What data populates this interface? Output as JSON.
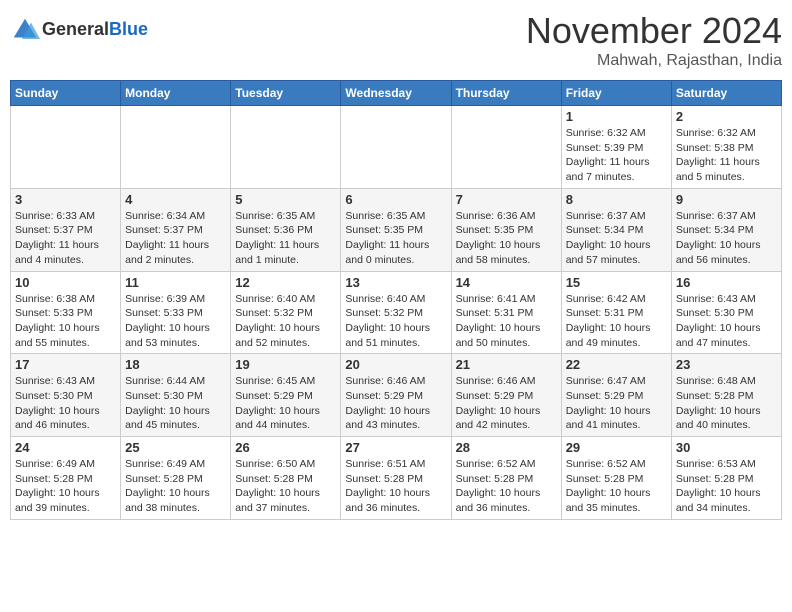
{
  "header": {
    "logo_line1": "General",
    "logo_line2": "Blue",
    "month": "November 2024",
    "location": "Mahwah, Rajasthan, India"
  },
  "weekdays": [
    "Sunday",
    "Monday",
    "Tuesday",
    "Wednesday",
    "Thursday",
    "Friday",
    "Saturday"
  ],
  "weeks": [
    [
      {
        "day": "",
        "info": ""
      },
      {
        "day": "",
        "info": ""
      },
      {
        "day": "",
        "info": ""
      },
      {
        "day": "",
        "info": ""
      },
      {
        "day": "",
        "info": ""
      },
      {
        "day": "1",
        "info": "Sunrise: 6:32 AM\nSunset: 5:39 PM\nDaylight: 11 hours and 7 minutes."
      },
      {
        "day": "2",
        "info": "Sunrise: 6:32 AM\nSunset: 5:38 PM\nDaylight: 11 hours and 5 minutes."
      }
    ],
    [
      {
        "day": "3",
        "info": "Sunrise: 6:33 AM\nSunset: 5:37 PM\nDaylight: 11 hours and 4 minutes."
      },
      {
        "day": "4",
        "info": "Sunrise: 6:34 AM\nSunset: 5:37 PM\nDaylight: 11 hours and 2 minutes."
      },
      {
        "day": "5",
        "info": "Sunrise: 6:35 AM\nSunset: 5:36 PM\nDaylight: 11 hours and 1 minute."
      },
      {
        "day": "6",
        "info": "Sunrise: 6:35 AM\nSunset: 5:35 PM\nDaylight: 11 hours and 0 minutes."
      },
      {
        "day": "7",
        "info": "Sunrise: 6:36 AM\nSunset: 5:35 PM\nDaylight: 10 hours and 58 minutes."
      },
      {
        "day": "8",
        "info": "Sunrise: 6:37 AM\nSunset: 5:34 PM\nDaylight: 10 hours and 57 minutes."
      },
      {
        "day": "9",
        "info": "Sunrise: 6:37 AM\nSunset: 5:34 PM\nDaylight: 10 hours and 56 minutes."
      }
    ],
    [
      {
        "day": "10",
        "info": "Sunrise: 6:38 AM\nSunset: 5:33 PM\nDaylight: 10 hours and 55 minutes."
      },
      {
        "day": "11",
        "info": "Sunrise: 6:39 AM\nSunset: 5:33 PM\nDaylight: 10 hours and 53 minutes."
      },
      {
        "day": "12",
        "info": "Sunrise: 6:40 AM\nSunset: 5:32 PM\nDaylight: 10 hours and 52 minutes."
      },
      {
        "day": "13",
        "info": "Sunrise: 6:40 AM\nSunset: 5:32 PM\nDaylight: 10 hours and 51 minutes."
      },
      {
        "day": "14",
        "info": "Sunrise: 6:41 AM\nSunset: 5:31 PM\nDaylight: 10 hours and 50 minutes."
      },
      {
        "day": "15",
        "info": "Sunrise: 6:42 AM\nSunset: 5:31 PM\nDaylight: 10 hours and 49 minutes."
      },
      {
        "day": "16",
        "info": "Sunrise: 6:43 AM\nSunset: 5:30 PM\nDaylight: 10 hours and 47 minutes."
      }
    ],
    [
      {
        "day": "17",
        "info": "Sunrise: 6:43 AM\nSunset: 5:30 PM\nDaylight: 10 hours and 46 minutes."
      },
      {
        "day": "18",
        "info": "Sunrise: 6:44 AM\nSunset: 5:30 PM\nDaylight: 10 hours and 45 minutes."
      },
      {
        "day": "19",
        "info": "Sunrise: 6:45 AM\nSunset: 5:29 PM\nDaylight: 10 hours and 44 minutes."
      },
      {
        "day": "20",
        "info": "Sunrise: 6:46 AM\nSunset: 5:29 PM\nDaylight: 10 hours and 43 minutes."
      },
      {
        "day": "21",
        "info": "Sunrise: 6:46 AM\nSunset: 5:29 PM\nDaylight: 10 hours and 42 minutes."
      },
      {
        "day": "22",
        "info": "Sunrise: 6:47 AM\nSunset: 5:29 PM\nDaylight: 10 hours and 41 minutes."
      },
      {
        "day": "23",
        "info": "Sunrise: 6:48 AM\nSunset: 5:28 PM\nDaylight: 10 hours and 40 minutes."
      }
    ],
    [
      {
        "day": "24",
        "info": "Sunrise: 6:49 AM\nSunset: 5:28 PM\nDaylight: 10 hours and 39 minutes."
      },
      {
        "day": "25",
        "info": "Sunrise: 6:49 AM\nSunset: 5:28 PM\nDaylight: 10 hours and 38 minutes."
      },
      {
        "day": "26",
        "info": "Sunrise: 6:50 AM\nSunset: 5:28 PM\nDaylight: 10 hours and 37 minutes."
      },
      {
        "day": "27",
        "info": "Sunrise: 6:51 AM\nSunset: 5:28 PM\nDaylight: 10 hours and 36 minutes."
      },
      {
        "day": "28",
        "info": "Sunrise: 6:52 AM\nSunset: 5:28 PM\nDaylight: 10 hours and 36 minutes."
      },
      {
        "day": "29",
        "info": "Sunrise: 6:52 AM\nSunset: 5:28 PM\nDaylight: 10 hours and 35 minutes."
      },
      {
        "day": "30",
        "info": "Sunrise: 6:53 AM\nSunset: 5:28 PM\nDaylight: 10 hours and 34 minutes."
      }
    ]
  ]
}
